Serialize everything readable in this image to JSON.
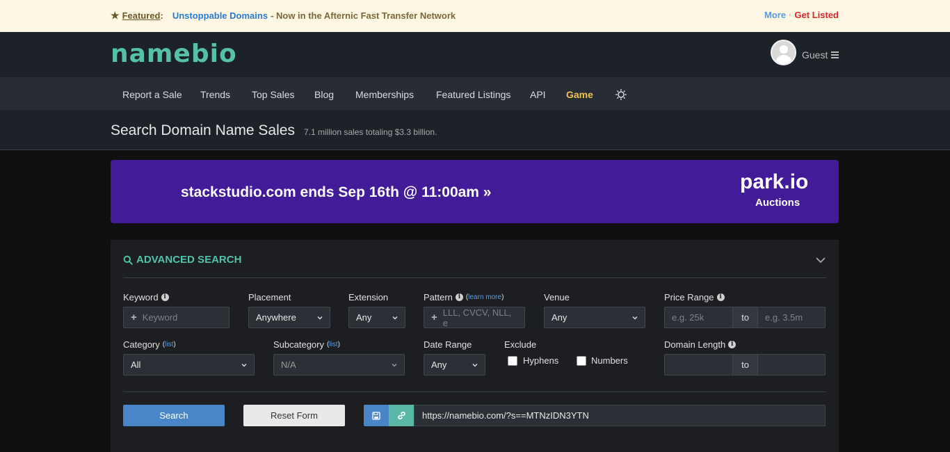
{
  "featured": {
    "label": "Featured",
    "colon": ":",
    "domain": "Unstoppable Domains",
    "text": " - Now in the Afternic Fast Transfer Network",
    "more": "More",
    "separator": "·",
    "get_listed": "Get Listed"
  },
  "header": {
    "logo": "namebio",
    "user": "Guest"
  },
  "nav": {
    "items": [
      "Report a Sale",
      "Trends",
      "Top Sales",
      "Blog",
      "Memberships",
      "Featured Listings",
      "API"
    ],
    "game": "Game"
  },
  "page": {
    "title": "Search Domain Name Sales",
    "subtitle": "7.1 million sales totaling $3.3 billion."
  },
  "banner": {
    "text": "stackstudio.com ends Sep 16th @ 11:00am »",
    "brand": "park.io",
    "brand_sub": "Auctions"
  },
  "search": {
    "heading": "ADVANCED SEARCH",
    "keyword": {
      "label": "Keyword",
      "placeholder": "Keyword"
    },
    "placement": {
      "label": "Placement",
      "value": "Anywhere"
    },
    "extension": {
      "label": "Extension",
      "value": "Any"
    },
    "pattern": {
      "label": "Pattern",
      "open_paren": "(",
      "learn_more": "learn more",
      "close_paren": ")",
      "placeholder": "LLL, CVCV, NLL, e"
    },
    "venue": {
      "label": "Venue",
      "value": "Any"
    },
    "price_range": {
      "label": "Price Range",
      "from_placeholder": "e.g. 25k",
      "to": "to",
      "to_placeholder": "e.g. 3.5m"
    },
    "category": {
      "label": "Category",
      "open_paren": "(",
      "list": "list",
      "close_paren": ")",
      "value": "All"
    },
    "subcategory": {
      "label": "Subcategory",
      "open_paren": "(",
      "list": "list",
      "close_paren": ")",
      "value": "N/A"
    },
    "date_range": {
      "label": "Date Range",
      "value": "Any"
    },
    "exclude": {
      "label": "Exclude",
      "hyphens": "Hyphens",
      "numbers": "Numbers"
    },
    "domain_length": {
      "label": "Domain Length",
      "to": "to"
    },
    "buttons": {
      "search": "Search",
      "reset": "Reset Form"
    },
    "url": "https://namebio.com/?s==MTNzIDN3YTN"
  }
}
